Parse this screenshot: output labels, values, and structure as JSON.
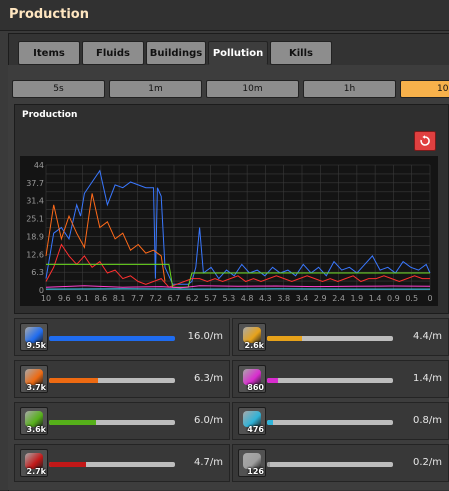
{
  "window": {
    "title": "Production"
  },
  "tabs": [
    {
      "label": "Items",
      "active": false
    },
    {
      "label": "Fluids",
      "active": false
    },
    {
      "label": "Buildings",
      "active": false
    },
    {
      "label": "Pollution",
      "active": true
    },
    {
      "label": "Kills",
      "active": false
    }
  ],
  "time_buttons": [
    {
      "label": "5s",
      "active": false
    },
    {
      "label": "1m",
      "active": false
    },
    {
      "label": "10m",
      "active": false
    },
    {
      "label": "1h",
      "active": false
    },
    {
      "label": "10",
      "active": true
    }
  ],
  "panel": {
    "title": "Production",
    "reset_icon": "reset-icon",
    "reset_color": "#e04040"
  },
  "chart_data": {
    "type": "line",
    "y_ticks": [
      "44",
      "37.7",
      "31.4",
      "25.1",
      "18.9",
      "12.6",
      "6.3",
      "0"
    ],
    "x_ticks": [
      "10",
      "9.6",
      "9.1",
      "8.6",
      "8.1",
      "7.7",
      "7.2",
      "6.7",
      "6.2",
      "5.7",
      "5.3",
      "4.8",
      "4.3",
      "3.8",
      "3.4",
      "2.9",
      "2.4",
      "1.9",
      "1.4",
      "0.9",
      "0.5",
      "0"
    ],
    "xlim": [
      10,
      0
    ],
    "ylim": [
      0,
      44
    ],
    "grid": true,
    "series": [
      {
        "color": "#3a78ff",
        "x": [
          10,
          9.8,
          9.6,
          9.4,
          9.2,
          9.1,
          9.0,
          8.8,
          8.6,
          8.4,
          8.2,
          8.0,
          7.8,
          7.6,
          7.4,
          7.3,
          7.2,
          7.15,
          7.1,
          7.0,
          6.9,
          6.7,
          6.5,
          6.3,
          6.2,
          6.1,
          6.0,
          5.9,
          5.7,
          5.5,
          5.3,
          5.1,
          4.9,
          4.7,
          4.5,
          4.3,
          4.1,
          3.9,
          3.7,
          3.5,
          3.3,
          3.1,
          2.9,
          2.7,
          2.5,
          2.3,
          2.1,
          1.9,
          1.7,
          1.5,
          1.3,
          1.1,
          0.9,
          0.7,
          0.5,
          0.3,
          0.1,
          0
        ],
        "values": [
          4,
          20,
          22,
          18,
          30,
          26,
          34,
          38,
          42,
          30,
          37,
          36,
          38,
          37,
          36,
          36,
          36,
          4,
          36,
          33,
          8,
          2,
          2,
          2,
          3,
          8,
          22,
          6,
          8,
          4,
          7,
          5,
          9,
          6,
          7,
          5,
          8,
          6,
          7,
          5,
          9,
          6,
          8,
          5,
          10,
          7,
          8,
          6,
          9,
          12,
          7,
          8,
          6,
          10,
          8,
          7,
          9,
          6
        ]
      },
      {
        "color": "#ff6a1a",
        "x": [
          10,
          9.8,
          9.6,
          9.4,
          9.2,
          9.0,
          8.8,
          8.6,
          8.4,
          8.2,
          8.0,
          7.8,
          7.6,
          7.4,
          7.2,
          7.0,
          6.9
        ],
        "values": [
          12,
          30,
          18,
          26,
          20,
          15,
          34,
          22,
          24,
          18,
          20,
          14,
          16,
          13,
          14,
          12,
          3
        ]
      },
      {
        "color": "#ff3030",
        "x": [
          10,
          9.8,
          9.6,
          9.4,
          9.2,
          9.0,
          8.8,
          8.6,
          8.4,
          8.2,
          8.0,
          7.8,
          7.6,
          7.4,
          7.2,
          7.0,
          6.8,
          6.6,
          6.4,
          6.2,
          6.0,
          5.8,
          5.6,
          5.4,
          5.2,
          5.0,
          4.8,
          4.6,
          4.4,
          4.2,
          4.0,
          3.8,
          3.6,
          3.4,
          3.2,
          3.0,
          2.8,
          2.6,
          2.4,
          2.2,
          2.0,
          1.8,
          1.6,
          1.4,
          1.2,
          1.0,
          0.8,
          0.6,
          0.4,
          0.2,
          0
        ],
        "values": [
          3,
          8,
          16,
          12,
          9,
          12,
          8,
          10,
          6,
          7,
          4,
          5,
          3,
          2,
          3,
          4,
          1,
          2,
          3,
          4,
          4,
          3,
          4,
          3,
          4,
          5,
          3,
          4,
          3,
          4,
          5,
          4,
          3,
          4,
          5,
          4,
          3,
          4,
          3,
          4,
          5,
          3,
          4,
          4,
          5,
          4,
          3,
          4,
          5,
          4,
          4
        ]
      },
      {
        "color": "#6ad81e",
        "x": [
          10,
          9.5,
          9.4,
          8.0,
          7.9,
          6.8,
          6.7,
          6.3,
          6.2,
          6.0,
          5.5,
          5.0,
          4.5,
          4.0,
          3.5,
          3.0,
          2.5,
          2.0,
          1.5,
          1.0,
          0.5,
          0
        ],
        "values": [
          9,
          9,
          9,
          9,
          9,
          9,
          1,
          1,
          6,
          6,
          6,
          6,
          6,
          6,
          6,
          6,
          6,
          6,
          6,
          6,
          6,
          6
        ]
      },
      {
        "color": "#ff40d0",
        "x": [
          10,
          9,
          8,
          7,
          6.5,
          6.2,
          6,
          5,
          4,
          3,
          2,
          1,
          0
        ],
        "values": [
          1,
          1.5,
          1,
          1.2,
          0.8,
          1.2,
          1.5,
          1.3,
          1.4,
          1.2,
          1.3,
          1.4,
          1.3
        ]
      },
      {
        "color": "#40d8ff",
        "x": [
          10,
          8,
          6,
          4,
          2,
          0
        ],
        "values": [
          0.3,
          0.4,
          0.3,
          0.4,
          0.3,
          0.3
        ]
      }
    ]
  },
  "rows": [
    {
      "count": "9.5k",
      "rate": "16.0/m",
      "fraction": 1.0,
      "color": "#1f6cf0",
      "icon": "mining-drill-icon"
    },
    {
      "count": "2.6k",
      "rate": "4.4/m",
      "fraction": 0.28,
      "color": "#e7a21a",
      "icon": "steam-engine-icon"
    },
    {
      "count": "3.7k",
      "rate": "6.3/m",
      "fraction": 0.39,
      "color": "#ee6a12",
      "icon": "furnace-icon"
    },
    {
      "count": "860",
      "rate": "1.4/m",
      "fraction": 0.09,
      "color": "#d92ccf",
      "icon": "boiler-icon"
    },
    {
      "count": "3.6k",
      "rate": "6.0/m",
      "fraction": 0.37,
      "color": "#56b01a",
      "icon": "tree-icon"
    },
    {
      "count": "476",
      "rate": "0.8/m",
      "fraction": 0.05,
      "color": "#2fb3d8",
      "icon": "assembler-icon"
    },
    {
      "count": "2.7k",
      "rate": "4.7/m",
      "fraction": 0.29,
      "color": "#c21818",
      "icon": "pump-icon"
    },
    {
      "count": "126",
      "rate": "0.2/m",
      "fraction": 0.02,
      "color": "#9e9e9e",
      "icon": "lab-icon"
    }
  ]
}
